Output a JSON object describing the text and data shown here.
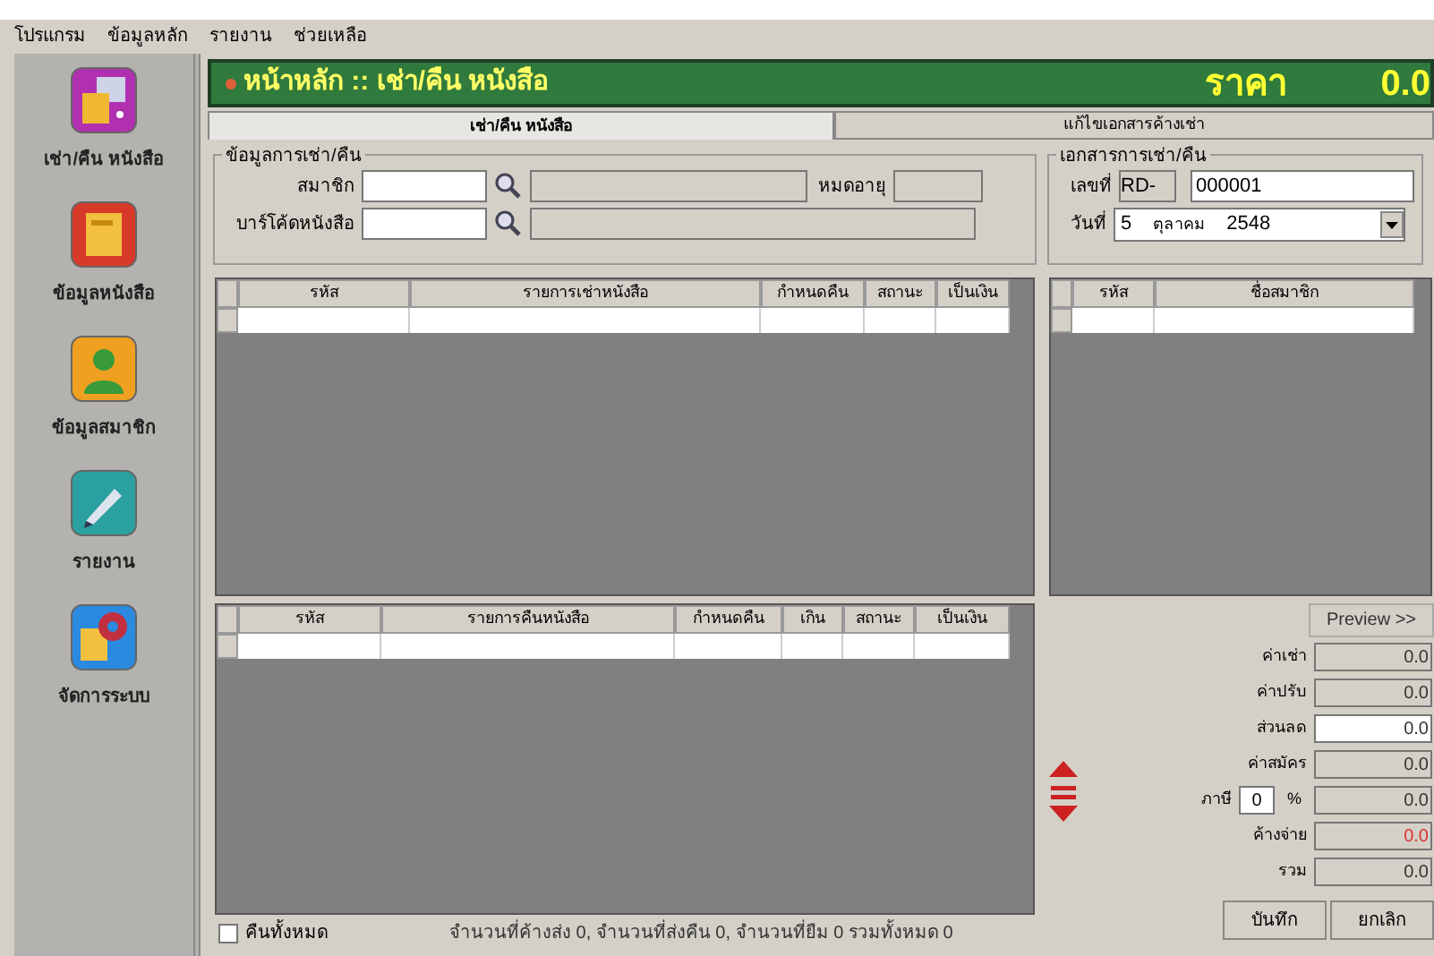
{
  "menu": [
    "โปรแกรม",
    "ข้อมูลหลัก",
    "รายงาน",
    "ช่วยเหลือ"
  ],
  "sidebar": {
    "items": [
      {
        "label": "เช่า/คืน หนังสือ",
        "kind": "rent"
      },
      {
        "label": "ข้อมูลหนังสือ",
        "kind": "book"
      },
      {
        "label": "ข้อมูลสมาชิก",
        "kind": "member"
      },
      {
        "label": "รายงาน",
        "kind": "report"
      },
      {
        "label": "จัดการระบบ",
        "kind": "system"
      }
    ]
  },
  "header": {
    "title": "หน้าหลัก :: เช่า/คืน หนังสือ",
    "price_label": "ราคา",
    "price": "0.0"
  },
  "tabs": [
    {
      "label": "เช่า/คืน หนังสือ",
      "selected": true
    },
    {
      "label": "แก้ไขเอกสารค้างเช่า",
      "selected": false
    }
  ],
  "rent_info": {
    "title": "ข้อมูลการเช่า/คืน",
    "member_label": "สมาชิก",
    "barcode_label": "บาร์โค้ดหนังสือ",
    "expiry_label": "หมดอายุ"
  },
  "document": {
    "title": "เอกสารการเช่า/คืน",
    "number_label": "เลขที่",
    "prefix": "RD-",
    "number": "000001",
    "date_label": "วันที่",
    "day": "5",
    "month": "ตุลาคม",
    "year": "2548"
  },
  "rent_table": {
    "columns": [
      "รหัส",
      "รายการเช่าหนังสือ",
      "กำหนดคืน",
      "สถานะ",
      "เป็นเงิน"
    ]
  },
  "return_table": {
    "columns": [
      "รหัส",
      "รายการคืนหนังสือ",
      "กำหนดคืน",
      "เกิน",
      "สถานะ",
      "เป็นเงิน"
    ]
  },
  "member_table": {
    "columns": [
      "รหัส",
      "ชื่อสมาชิก"
    ]
  },
  "preview_button": "Preview >>",
  "totals": [
    {
      "label": "ค่าเช่า",
      "value": "0.0",
      "kind": "readonly"
    },
    {
      "label": "ค่าปรับ",
      "value": "0.0",
      "kind": "readonly"
    },
    {
      "label": "ส่วนลด",
      "value": "0.0",
      "kind": "editable"
    },
    {
      "label": "ค่าสมัคร",
      "value": "0.0",
      "kind": "readonly"
    },
    {
      "label": "ภาษี",
      "value": "0.0",
      "kind": "tax",
      "rate": "0",
      "unit": "%"
    },
    {
      "label": "ค้างจ่าย",
      "value": "0.0",
      "kind": "due"
    },
    {
      "label": "รวม",
      "value": "0.0",
      "kind": "readonly"
    }
  ],
  "return_all": {
    "label": "คืนทั้งหมด",
    "checked": false
  },
  "summary": "จำนวนที่ค้างส่ง 0, จำนวนที่ส่งคืน 0, จำนวนที่ยืม 0 รวมทั้งหมด 0",
  "buttons": [
    "บันทึก",
    "ยกเลิก"
  ]
}
